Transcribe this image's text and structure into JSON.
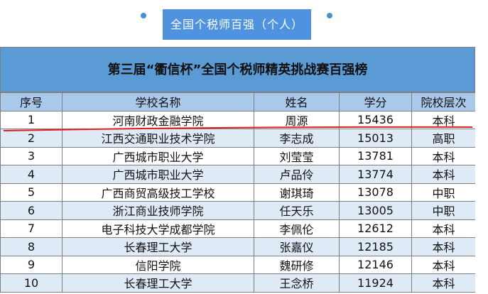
{
  "tab": {
    "label": "全国个税师百强（个人）"
  },
  "table": {
    "title": "第三届“衢信杯”全国个税师精英挑战赛百强榜",
    "headers": [
      "序号",
      "学校名称",
      "姓名",
      "学分",
      "院校层次"
    ],
    "rows": [
      [
        "1",
        "河南财政金融学院",
        "周源",
        "15436",
        "本科"
      ],
      [
        "2",
        "江西交通职业技术学院",
        "李志成",
        "15013",
        "高职"
      ],
      [
        "3",
        "广西城市职业大学",
        "刘莹莹",
        "13781",
        "本科"
      ],
      [
        "4",
        "广西城市职业大学",
        "卢品伶",
        "13774",
        "本科"
      ],
      [
        "5",
        "广西商贸高级技工学校",
        "谢琪琦",
        "13078",
        "中职"
      ],
      [
        "6",
        "浙江商业技师学院",
        "任天乐",
        "13005",
        "中职"
      ],
      [
        "7",
        "电子科技大学成都学院",
        "李佩伦",
        "12612",
        "本科"
      ],
      [
        "8",
        "长春理工大学",
        "张嘉仪",
        "12185",
        "本科"
      ],
      [
        "9",
        "信阳学院",
        "魏研修",
        "12146",
        "本科"
      ],
      [
        "10",
        "长春理工大学",
        "王念桥",
        "11924",
        "本科"
      ]
    ]
  },
  "colors": {
    "tab_bg": "#4f93e0",
    "title_bg": "#5b9bd5",
    "header_bg": "#a9c9ea",
    "stripe_bg": "#deebf7",
    "annotation_line": "#e0201c"
  }
}
